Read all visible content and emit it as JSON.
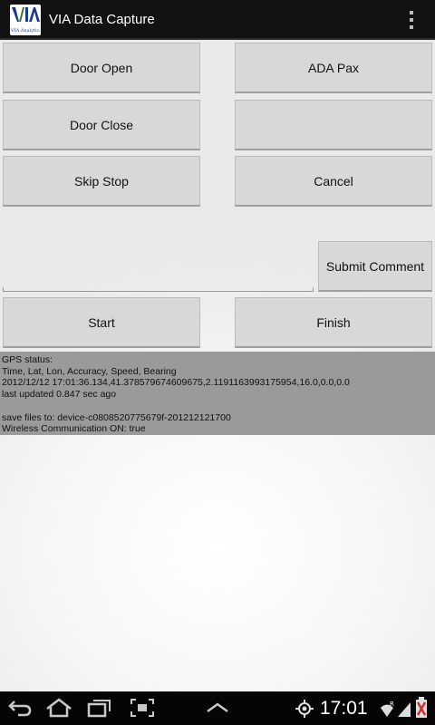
{
  "app": {
    "title": "VIA Data Capture",
    "logo_text": "VIA",
    "logo_subtext": "VIA Analytics"
  },
  "buttons": {
    "door_open": "Door Open",
    "ada_pax": "ADA Pax",
    "door_close": "Door Close",
    "blank": "",
    "skip_stop": "Skip Stop",
    "cancel": "Cancel",
    "submit_comment": "Submit Comment",
    "start": "Start",
    "finish": "Finish"
  },
  "comment": {
    "value": "",
    "placeholder": ""
  },
  "status": {
    "gps_label": "GPS status:",
    "fields_header": "Time, Lat, Lon, Accuracy, Speed, Bearing",
    "gps_values": "2012/12/12 17:01:36.134,41.378579674609675,2.1191163993175954,16.0,0.0,0.0",
    "last_updated": "last updated 0.847 sec ago",
    "save_files": "save files to: device-c0808520775679f-201212121700",
    "wireless": "Wireless Communication ON: true"
  },
  "navbar": {
    "time": "17:01",
    "icons": [
      "back-icon",
      "home-icon",
      "recent-apps-icon",
      "screenshot-icon",
      "menu-up-icon",
      "gps-icon",
      "wifi-icon",
      "signal-icon",
      "battery-icon"
    ]
  },
  "colors": {
    "actionbar": "#121212",
    "button": "#d8d8d8",
    "status_panel": "#9a9a9a",
    "logo_blue": "#1a3a8a",
    "logo_green": "#2e7d32"
  }
}
